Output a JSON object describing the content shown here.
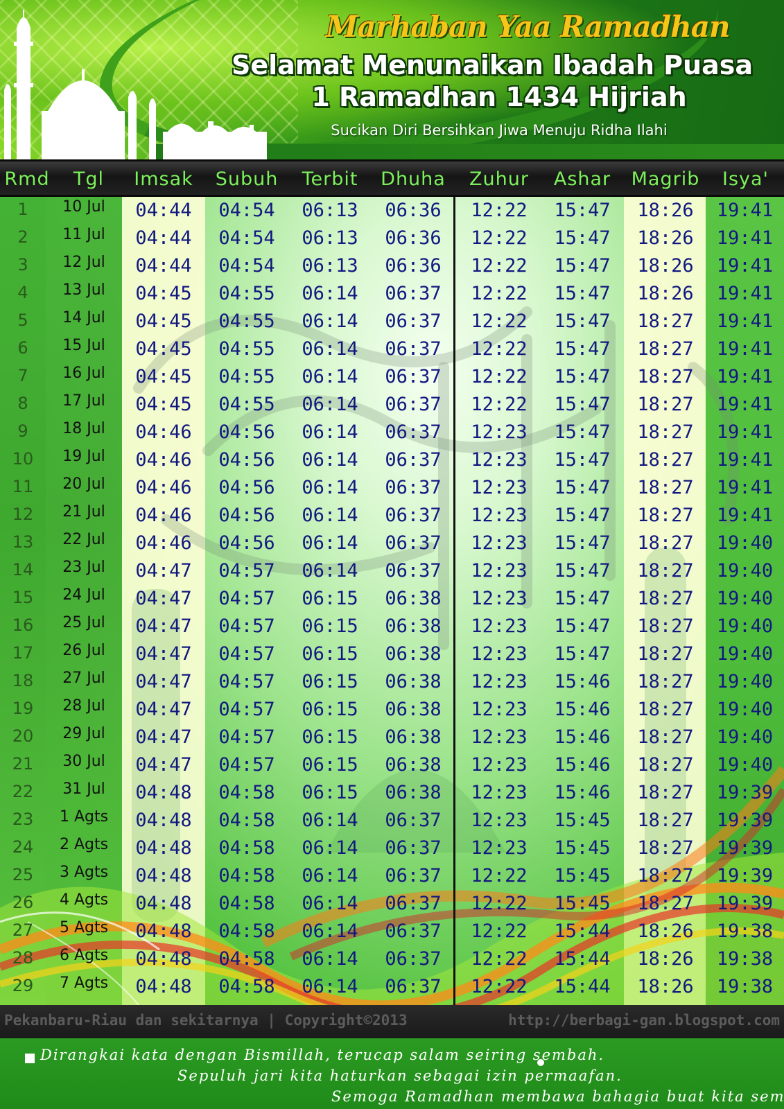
{
  "header": {
    "script_title": "Marhaban Yaa Ramadhan",
    "main_title": "Selamat Menunaikan Ibadah Puasa",
    "sub_title": "1 Ramadhan 1434 Hijriah",
    "tagline": "Sucikan Diri Bersihkan Jiwa Menuju Ridha Ilahi"
  },
  "table": {
    "columns": [
      "Rmd",
      "Tgl",
      "Imsak",
      "Subuh",
      "Terbit",
      "Dhuha",
      "Zuhur",
      "Ashar",
      "Magrib",
      "Isya'"
    ],
    "rows": [
      [
        "1",
        "10 Jul",
        "04:44",
        "04:54",
        "06:13",
        "06:36",
        "12:22",
        "15:47",
        "18:26",
        "19:41"
      ],
      [
        "2",
        "11 Jul",
        "04:44",
        "04:54",
        "06:13",
        "06:36",
        "12:22",
        "15:47",
        "18:26",
        "19:41"
      ],
      [
        "3",
        "12 Jul",
        "04:44",
        "04:54",
        "06:13",
        "06:36",
        "12:22",
        "15:47",
        "18:26",
        "19:41"
      ],
      [
        "4",
        "13 Jul",
        "04:45",
        "04:55",
        "06:14",
        "06:37",
        "12:22",
        "15:47",
        "18:26",
        "19:41"
      ],
      [
        "5",
        "14 Jul",
        "04:45",
        "04:55",
        "06:14",
        "06:37",
        "12:22",
        "15:47",
        "18:27",
        "19:41"
      ],
      [
        "6",
        "15 Jul",
        "04:45",
        "04:55",
        "06:14",
        "06:37",
        "12:22",
        "15:47",
        "18:27",
        "19:41"
      ],
      [
        "7",
        "16 Jul",
        "04:45",
        "04:55",
        "06:14",
        "06:37",
        "12:22",
        "15:47",
        "18:27",
        "19:41"
      ],
      [
        "8",
        "17 Jul",
        "04:45",
        "04:55",
        "06:14",
        "06:37",
        "12:22",
        "15:47",
        "18:27",
        "19:41"
      ],
      [
        "9",
        "18 Jul",
        "04:46",
        "04:56",
        "06:14",
        "06:37",
        "12:23",
        "15:47",
        "18:27",
        "19:41"
      ],
      [
        "10",
        "19 Jul",
        "04:46",
        "04:56",
        "06:14",
        "06:37",
        "12:23",
        "15:47",
        "18:27",
        "19:41"
      ],
      [
        "11",
        "20 Jul",
        "04:46",
        "04:56",
        "06:14",
        "06:37",
        "12:23",
        "15:47",
        "18:27",
        "19:41"
      ],
      [
        "12",
        "21 Jul",
        "04:46",
        "04:56",
        "06:14",
        "06:37",
        "12:23",
        "15:47",
        "18:27",
        "19:41"
      ],
      [
        "13",
        "22 Jul",
        "04:46",
        "04:56",
        "06:14",
        "06:37",
        "12:23",
        "15:47",
        "18:27",
        "19:40"
      ],
      [
        "14",
        "23 Jul",
        "04:47",
        "04:57",
        "06:14",
        "06:37",
        "12:23",
        "15:47",
        "18:27",
        "19:40"
      ],
      [
        "15",
        "24 Jul",
        "04:47",
        "04:57",
        "06:15",
        "06:38",
        "12:23",
        "15:47",
        "18:27",
        "19:40"
      ],
      [
        "16",
        "25 Jul",
        "04:47",
        "04:57",
        "06:15",
        "06:38",
        "12:23",
        "15:47",
        "18:27",
        "19:40"
      ],
      [
        "17",
        "26 Jul",
        "04:47",
        "04:57",
        "06:15",
        "06:38",
        "12:23",
        "15:47",
        "18:27",
        "19:40"
      ],
      [
        "18",
        "27 Jul",
        "04:47",
        "04:57",
        "06:15",
        "06:38",
        "12:23",
        "15:46",
        "18:27",
        "19:40"
      ],
      [
        "19",
        "28 Jul",
        "04:47",
        "04:57",
        "06:15",
        "06:38",
        "12:23",
        "15:46",
        "18:27",
        "19:40"
      ],
      [
        "20",
        "29 Jul",
        "04:47",
        "04:57",
        "06:15",
        "06:38",
        "12:23",
        "15:46",
        "18:27",
        "19:40"
      ],
      [
        "21",
        "30 Jul",
        "04:47",
        "04:57",
        "06:15",
        "06:38",
        "12:23",
        "15:46",
        "18:27",
        "19:40"
      ],
      [
        "22",
        "31 Jul",
        "04:48",
        "04:58",
        "06:15",
        "06:38",
        "12:23",
        "15:46",
        "18:27",
        "19:39"
      ],
      [
        "23",
        "1 Agts",
        "04:48",
        "04:58",
        "06:14",
        "06:37",
        "12:23",
        "15:45",
        "18:27",
        "19:39"
      ],
      [
        "24",
        "2 Agts",
        "04:48",
        "04:58",
        "06:14",
        "06:37",
        "12:23",
        "15:45",
        "18:27",
        "19:39"
      ],
      [
        "25",
        "3 Agts",
        "04:48",
        "04:58",
        "06:14",
        "06:37",
        "12:22",
        "15:45",
        "18:27",
        "19:39"
      ],
      [
        "26",
        "4 Agts",
        "04:48",
        "04:58",
        "06:14",
        "06:37",
        "12:22",
        "15:45",
        "18:27",
        "19:39"
      ],
      [
        "27",
        "5 Agts",
        "04:48",
        "04:58",
        "06:14",
        "06:37",
        "12:22",
        "15:44",
        "18:26",
        "19:38"
      ],
      [
        "28",
        "6 Agts",
        "04:48",
        "04:58",
        "06:14",
        "06:37",
        "12:22",
        "15:44",
        "18:26",
        "19:38"
      ],
      [
        "29",
        "7 Agts",
        "04:48",
        "04:58",
        "06:14",
        "06:37",
        "12:22",
        "15:44",
        "18:26",
        "19:38"
      ]
    ]
  },
  "footer": {
    "location": "Pekanbaru-Riau dan sekitarnya | Copyright©2013",
    "url": "http://berbagi-gan.blogspot.com"
  },
  "poem": {
    "line1": "Dirangkai kata dengan Bismillah, terucap salam seiring sembah.",
    "line2": "Sepuluh jari kita haturkan sebagai izin permaafan.",
    "line3": "Semoga Ramadhan membawa bahagia buat kita semua. Amin"
  },
  "colors": {
    "header_text": "#7cf25a",
    "time_text": "#121880",
    "script_gold": "#f5c518"
  }
}
